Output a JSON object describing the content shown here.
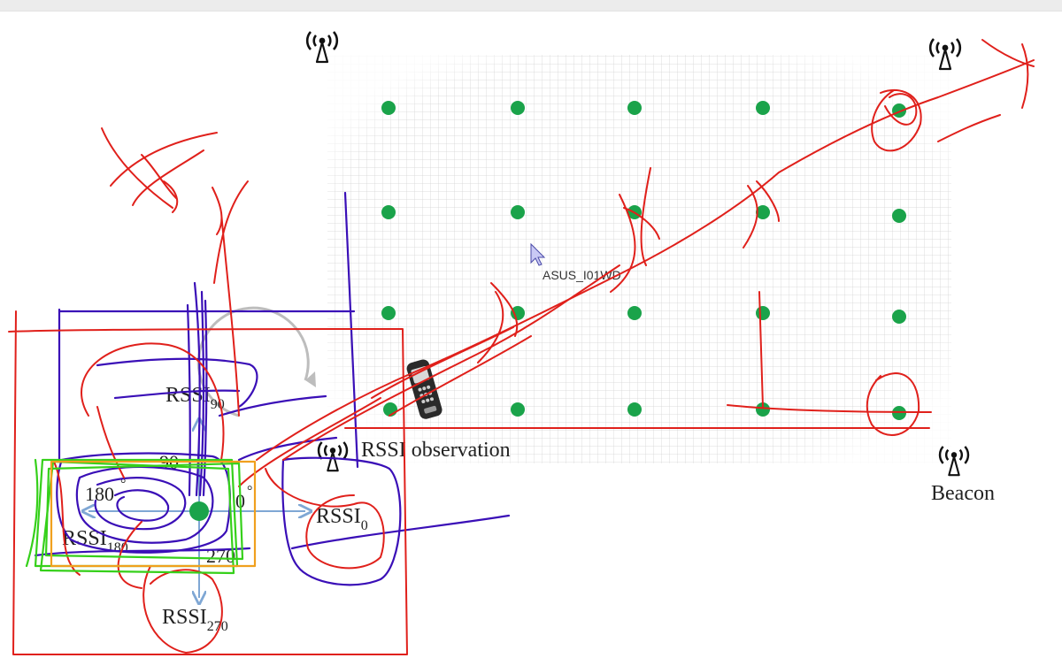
{
  "window": {
    "top_bar": ""
  },
  "diagram": {
    "beacon_label": "Beacon",
    "rssi_observation_label": "RSSI observation",
    "device_name": "ASUS_I01WD",
    "rssi": {
      "r90_main": "RSSI",
      "r90_sub": "90",
      "r0_main": "RSSI",
      "r0_sub": "0",
      "r180_main": "RSSI",
      "r180_sub": "180",
      "r270_main": "RSSI",
      "r270_sub": "270"
    },
    "angles": {
      "a90": "90",
      "a180": "180",
      "a0": "0",
      "a270": "270",
      "degree": "°"
    }
  },
  "colors": {
    "grid_dot": "#1aa34a",
    "grid_line": "#d4d4d4",
    "arrow": "#7fa7d4",
    "ink_red": "#e0201b",
    "ink_blue": "#3a0fb7",
    "ink_green": "#35d01a",
    "ink_orange": "#f0a01e",
    "rotate_gray": "#bdbdbd"
  },
  "icons": [
    "antenna-icon",
    "phone-icon",
    "mouse-cursor-icon",
    "rotate-arrow-icon"
  ]
}
